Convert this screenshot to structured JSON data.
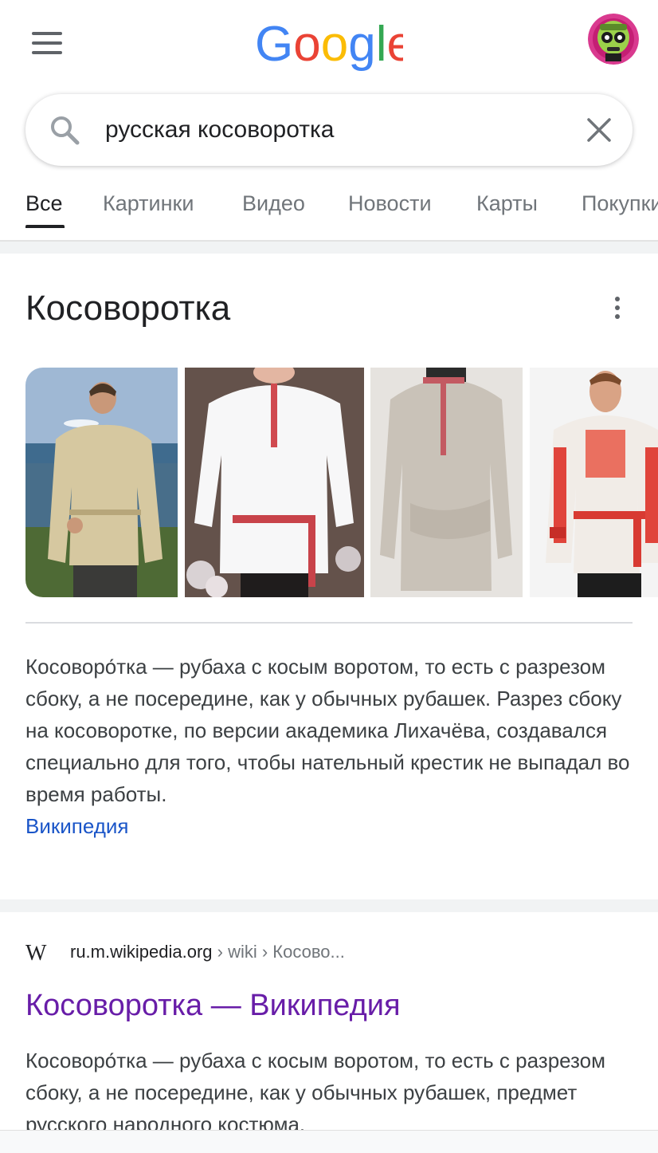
{
  "header": {
    "logo_text": "Google",
    "logo_colors": [
      "#4285F4",
      "#EA4335",
      "#FBBC05",
      "#4285F4",
      "#34A853",
      "#EA4335"
    ]
  },
  "search": {
    "query": "русская косоворотка"
  },
  "tabs": [
    {
      "label": "Все",
      "active": true
    },
    {
      "label": "Картинки",
      "active": false
    },
    {
      "label": "Видео",
      "active": false
    },
    {
      "label": "Новости",
      "active": false
    },
    {
      "label": "Карты",
      "active": false
    },
    {
      "label": "Покупки",
      "active": false
    }
  ],
  "knowledge_panel": {
    "title": "Косоворотка",
    "description": "Косоворо́тка — рубаха с косым воротом, то есть с разрезом сбоку, а не посередине, как у обычных рубашек. Разрез сбоку на косоворотке, по версии академика Лихачёва, создавался специально для того, чтобы нательный крестик не выпадал во время работы.",
    "source": "Википедия"
  },
  "result": {
    "favicon": "W",
    "domain": "ru.m.wikipedia.org",
    "path": " › wiki › Косово...",
    "title": "Косоворотка — Википедия",
    "snippet": "Косоворо́тка — рубаха с косым воротом, то есть с разрезом сбоку, а не посередине, как у обычных рубашек, предмет русского народного костюма."
  },
  "colors": {
    "link_blue": "#1a55c8",
    "visited_purple": "#681da8",
    "text_gray": "#70757a"
  }
}
